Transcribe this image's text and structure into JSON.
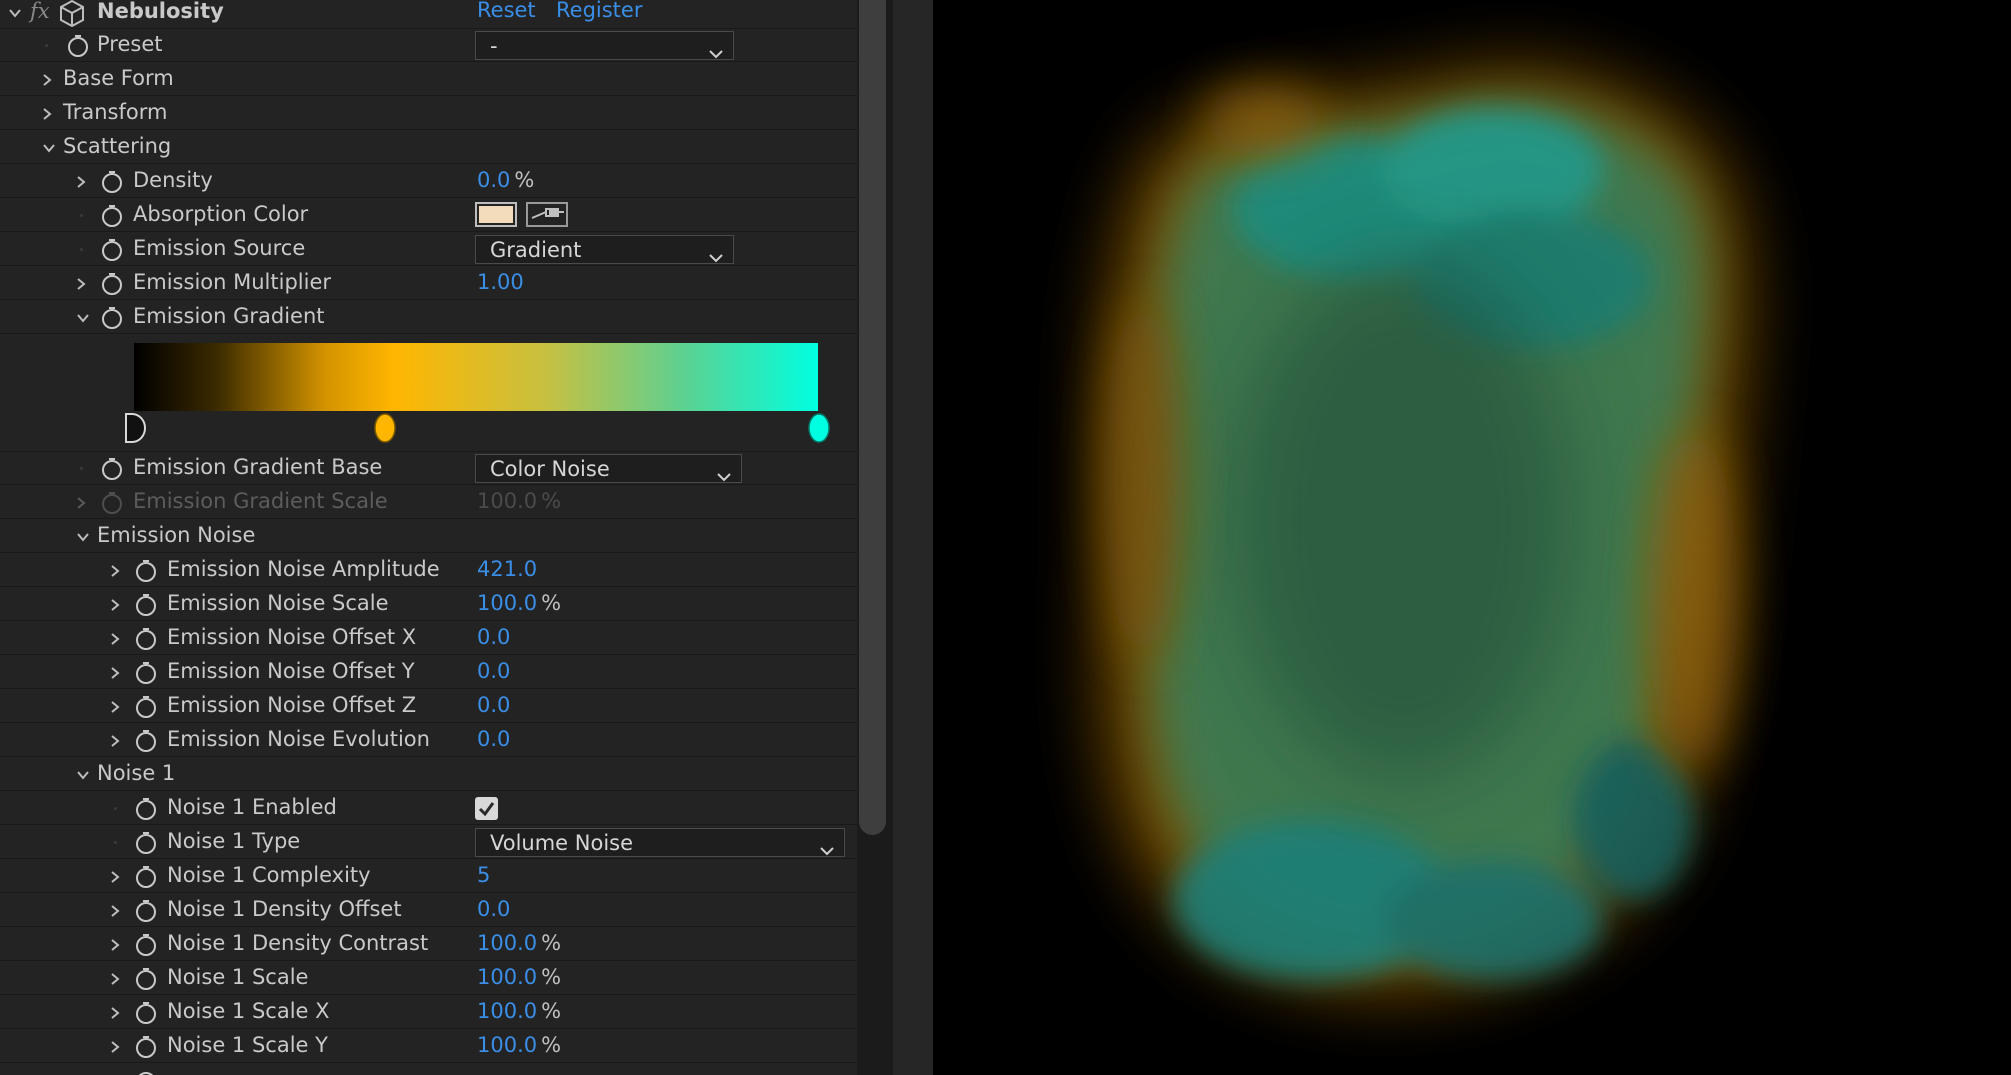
{
  "effect": {
    "fx_label": "fx",
    "name": "Nebulosity",
    "reset_label": "Reset",
    "register_label": "Register"
  },
  "properties": {
    "preset": {
      "label": "Preset",
      "value": "-"
    },
    "base_form": {
      "label": "Base Form"
    },
    "transform": {
      "label": "Transform"
    },
    "scattering": {
      "label": "Scattering"
    },
    "density": {
      "label": "Density",
      "value": "0.0",
      "unit": "%"
    },
    "absorption_color": {
      "label": "Absorption Color",
      "color": "#f3dcbb"
    },
    "emission_source": {
      "label": "Emission Source",
      "value": "Gradient"
    },
    "emission_multiplier": {
      "label": "Emission Multiplier",
      "value": "1.00"
    },
    "emission_gradient": {
      "label": "Emission Gradient",
      "stop_colors": [
        "#000000",
        "#ffb600",
        "#00ffe0"
      ]
    },
    "emission_gradient_base": {
      "label": "Emission Gradient Base",
      "value": "Color Noise"
    },
    "emission_gradient_scale": {
      "label": "Emission Gradient Scale",
      "value": "100.0",
      "unit": "%"
    },
    "emission_noise": {
      "label": "Emission Noise"
    },
    "emission_noise_amplitude": {
      "label": "Emission Noise Amplitude",
      "value": "421.0"
    },
    "emission_noise_scale": {
      "label": "Emission Noise Scale",
      "value": "100.0",
      "unit": "%"
    },
    "emission_noise_offset_x": {
      "label": "Emission Noise Offset X",
      "value": "0.0"
    },
    "emission_noise_offset_y": {
      "label": "Emission Noise Offset Y",
      "value": "0.0"
    },
    "emission_noise_offset_z": {
      "label": "Emission Noise Offset Z",
      "value": "0.0"
    },
    "emission_noise_evolution": {
      "label": "Emission Noise Evolution",
      "value": "0.0"
    },
    "noise1": {
      "label": "Noise 1"
    },
    "noise1_enabled": {
      "label": "Noise 1 Enabled",
      "checked": true
    },
    "noise1_type": {
      "label": "Noise 1 Type",
      "value": "Volume Noise"
    },
    "noise1_complexity": {
      "label": "Noise 1 Complexity",
      "value": "5"
    },
    "noise1_density_offset": {
      "label": "Noise 1 Density Offset",
      "value": "0.0"
    },
    "noise1_density_contrast": {
      "label": "Noise 1 Density Contrast",
      "value": "100.0",
      "unit": "%"
    },
    "noise1_scale": {
      "label": "Noise 1 Scale",
      "value": "100.0",
      "unit": "%"
    },
    "noise1_scale_x": {
      "label": "Noise 1 Scale X",
      "value": "100.0",
      "unit": "%"
    },
    "noise1_scale_y": {
      "label": "Noise 1 Scale Y",
      "value": "100.0",
      "unit": "%"
    }
  },
  "colors": {
    "panel_bg": "#232323",
    "value_blue": "#3a8ee6",
    "viewer_bg": "#000000"
  }
}
